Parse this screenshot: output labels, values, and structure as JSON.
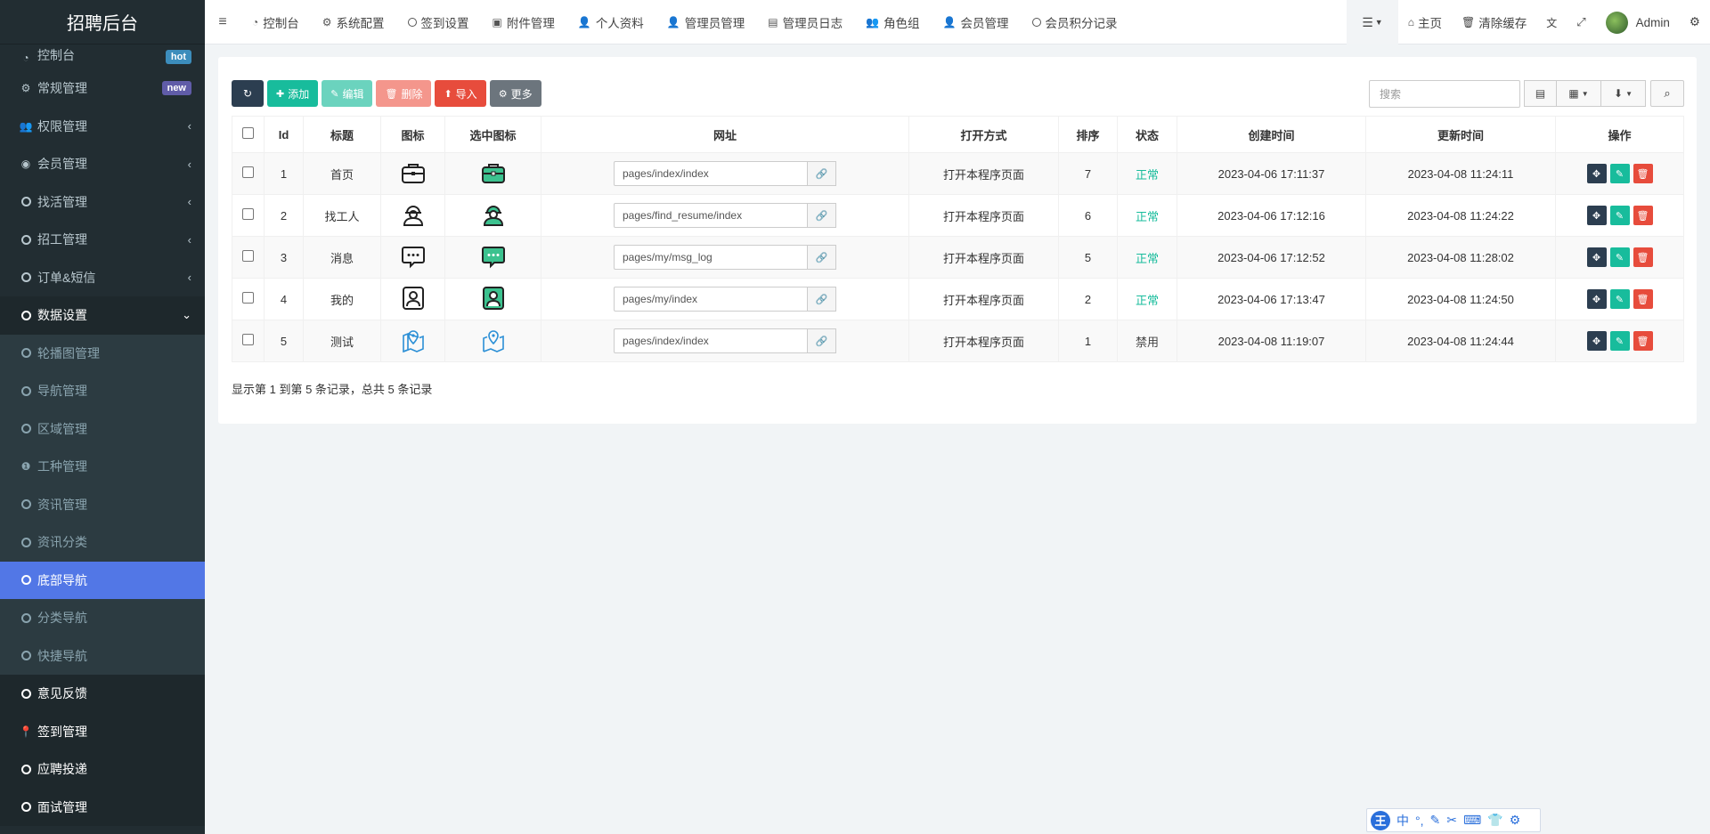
{
  "app": {
    "logo": "招聘后台"
  },
  "sidebar": {
    "items_top": [
      {
        "label": "控制台",
        "badge": "hot"
      },
      {
        "label": "常规管理",
        "badge": "new"
      },
      {
        "label": "权限管理",
        "arrow": "‹"
      },
      {
        "label": "会员管理",
        "arrow": "‹"
      },
      {
        "label": "找活管理",
        "arrow": "‹"
      },
      {
        "label": "招工管理",
        "arrow": "‹"
      },
      {
        "label": "订单&短信",
        "arrow": "‹"
      },
      {
        "label": "数据设置",
        "arrow": "⌄"
      }
    ],
    "submenu": [
      {
        "label": "轮播图管理"
      },
      {
        "label": "导航管理"
      },
      {
        "label": "区域管理"
      },
      {
        "label": "工种管理"
      },
      {
        "label": "资讯管理"
      },
      {
        "label": "资讯分类"
      },
      {
        "label": "底部导航"
      },
      {
        "label": "分类导航"
      },
      {
        "label": "快捷导航"
      }
    ],
    "items_bottom": [
      {
        "label": "意见反馈"
      },
      {
        "label": "签到管理"
      },
      {
        "label": "应聘投递"
      },
      {
        "label": "面试管理"
      }
    ]
  },
  "topnav": {
    "items": [
      {
        "label": "控制台"
      },
      {
        "label": "系统配置"
      },
      {
        "label": "签到设置"
      },
      {
        "label": "附件管理"
      },
      {
        "label": "个人资料"
      },
      {
        "label": "管理员管理"
      },
      {
        "label": "管理员日志"
      },
      {
        "label": "角色组"
      },
      {
        "label": "会员管理"
      },
      {
        "label": "会员积分记录"
      }
    ],
    "right": {
      "home": "主页",
      "clear_cache": "清除缓存",
      "user": "Admin"
    }
  },
  "toolbar": {
    "add": "添加",
    "edit": "编辑",
    "delete": "删除",
    "import": "导入",
    "more": "更多",
    "search_placeholder": "搜索"
  },
  "table": {
    "headers": {
      "id": "Id",
      "title": "标题",
      "icon": "图标",
      "selected_icon": "选中图标",
      "url": "网址",
      "open_mode": "打开方式",
      "sort": "排序",
      "status": "状态",
      "created": "创建时间",
      "updated": "更新时间",
      "ops": "操作"
    },
    "rows": [
      {
        "id": "1",
        "title": "首页",
        "url": "pages/index/index",
        "open_mode": "打开本程序页面",
        "sort": "7",
        "status": "正常",
        "created": "2023-04-06 17:11:37",
        "updated": "2023-04-08 11:24:11"
      },
      {
        "id": "2",
        "title": "找工人",
        "url": "pages/find_resume/index",
        "open_mode": "打开本程序页面",
        "sort": "6",
        "status": "正常",
        "created": "2023-04-06 17:12:16",
        "updated": "2023-04-08 11:24:22"
      },
      {
        "id": "3",
        "title": "消息",
        "url": "pages/my/msg_log",
        "open_mode": "打开本程序页面",
        "sort": "5",
        "status": "正常",
        "created": "2023-04-06 17:12:52",
        "updated": "2023-04-08 11:28:02"
      },
      {
        "id": "4",
        "title": "我的",
        "url": "pages/my/index",
        "open_mode": "打开本程序页面",
        "sort": "2",
        "status": "正常",
        "created": "2023-04-06 17:13:47",
        "updated": "2023-04-08 11:24:50"
      },
      {
        "id": "5",
        "title": "测试",
        "url": "pages/index/index",
        "open_mode": "打开本程序页面",
        "sort": "1",
        "status": "禁用",
        "created": "2023-04-08 11:19:07",
        "updated": "2023-04-08 11:24:44"
      }
    ]
  },
  "pagination": {
    "info": "显示第 1 到第 5 条记录，总共 5 条记录"
  },
  "ime": {
    "mode": "中",
    "brand": "王"
  },
  "colors": {
    "sidebar_bg": "#222d32",
    "active": "#5277e6",
    "success": "#18bc9c",
    "danger": "#e74c3c"
  }
}
